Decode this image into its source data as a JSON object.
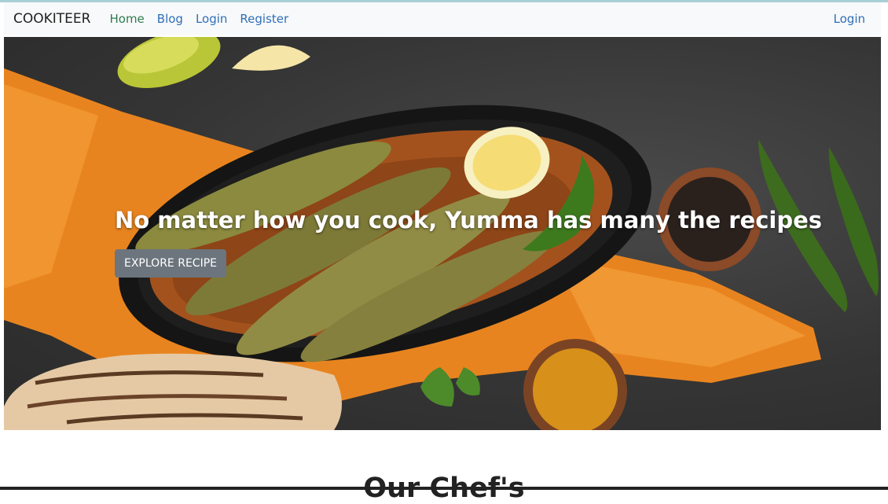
{
  "nav": {
    "brand": "COOKITEER",
    "links": [
      "Home",
      "Blog",
      "Login",
      "Register"
    ],
    "right_link": "Login"
  },
  "hero": {
    "title": "No matter how you cook, Yumma has many the recipes",
    "button_label": "EXPLORE RECIPE"
  },
  "section": {
    "title": "Our Chef's"
  },
  "colors": {
    "nav_bg": "#f8f9fa",
    "link": "#2f6fb8",
    "active_link": "#2e7d4f",
    "button_bg": "#6c757d"
  }
}
